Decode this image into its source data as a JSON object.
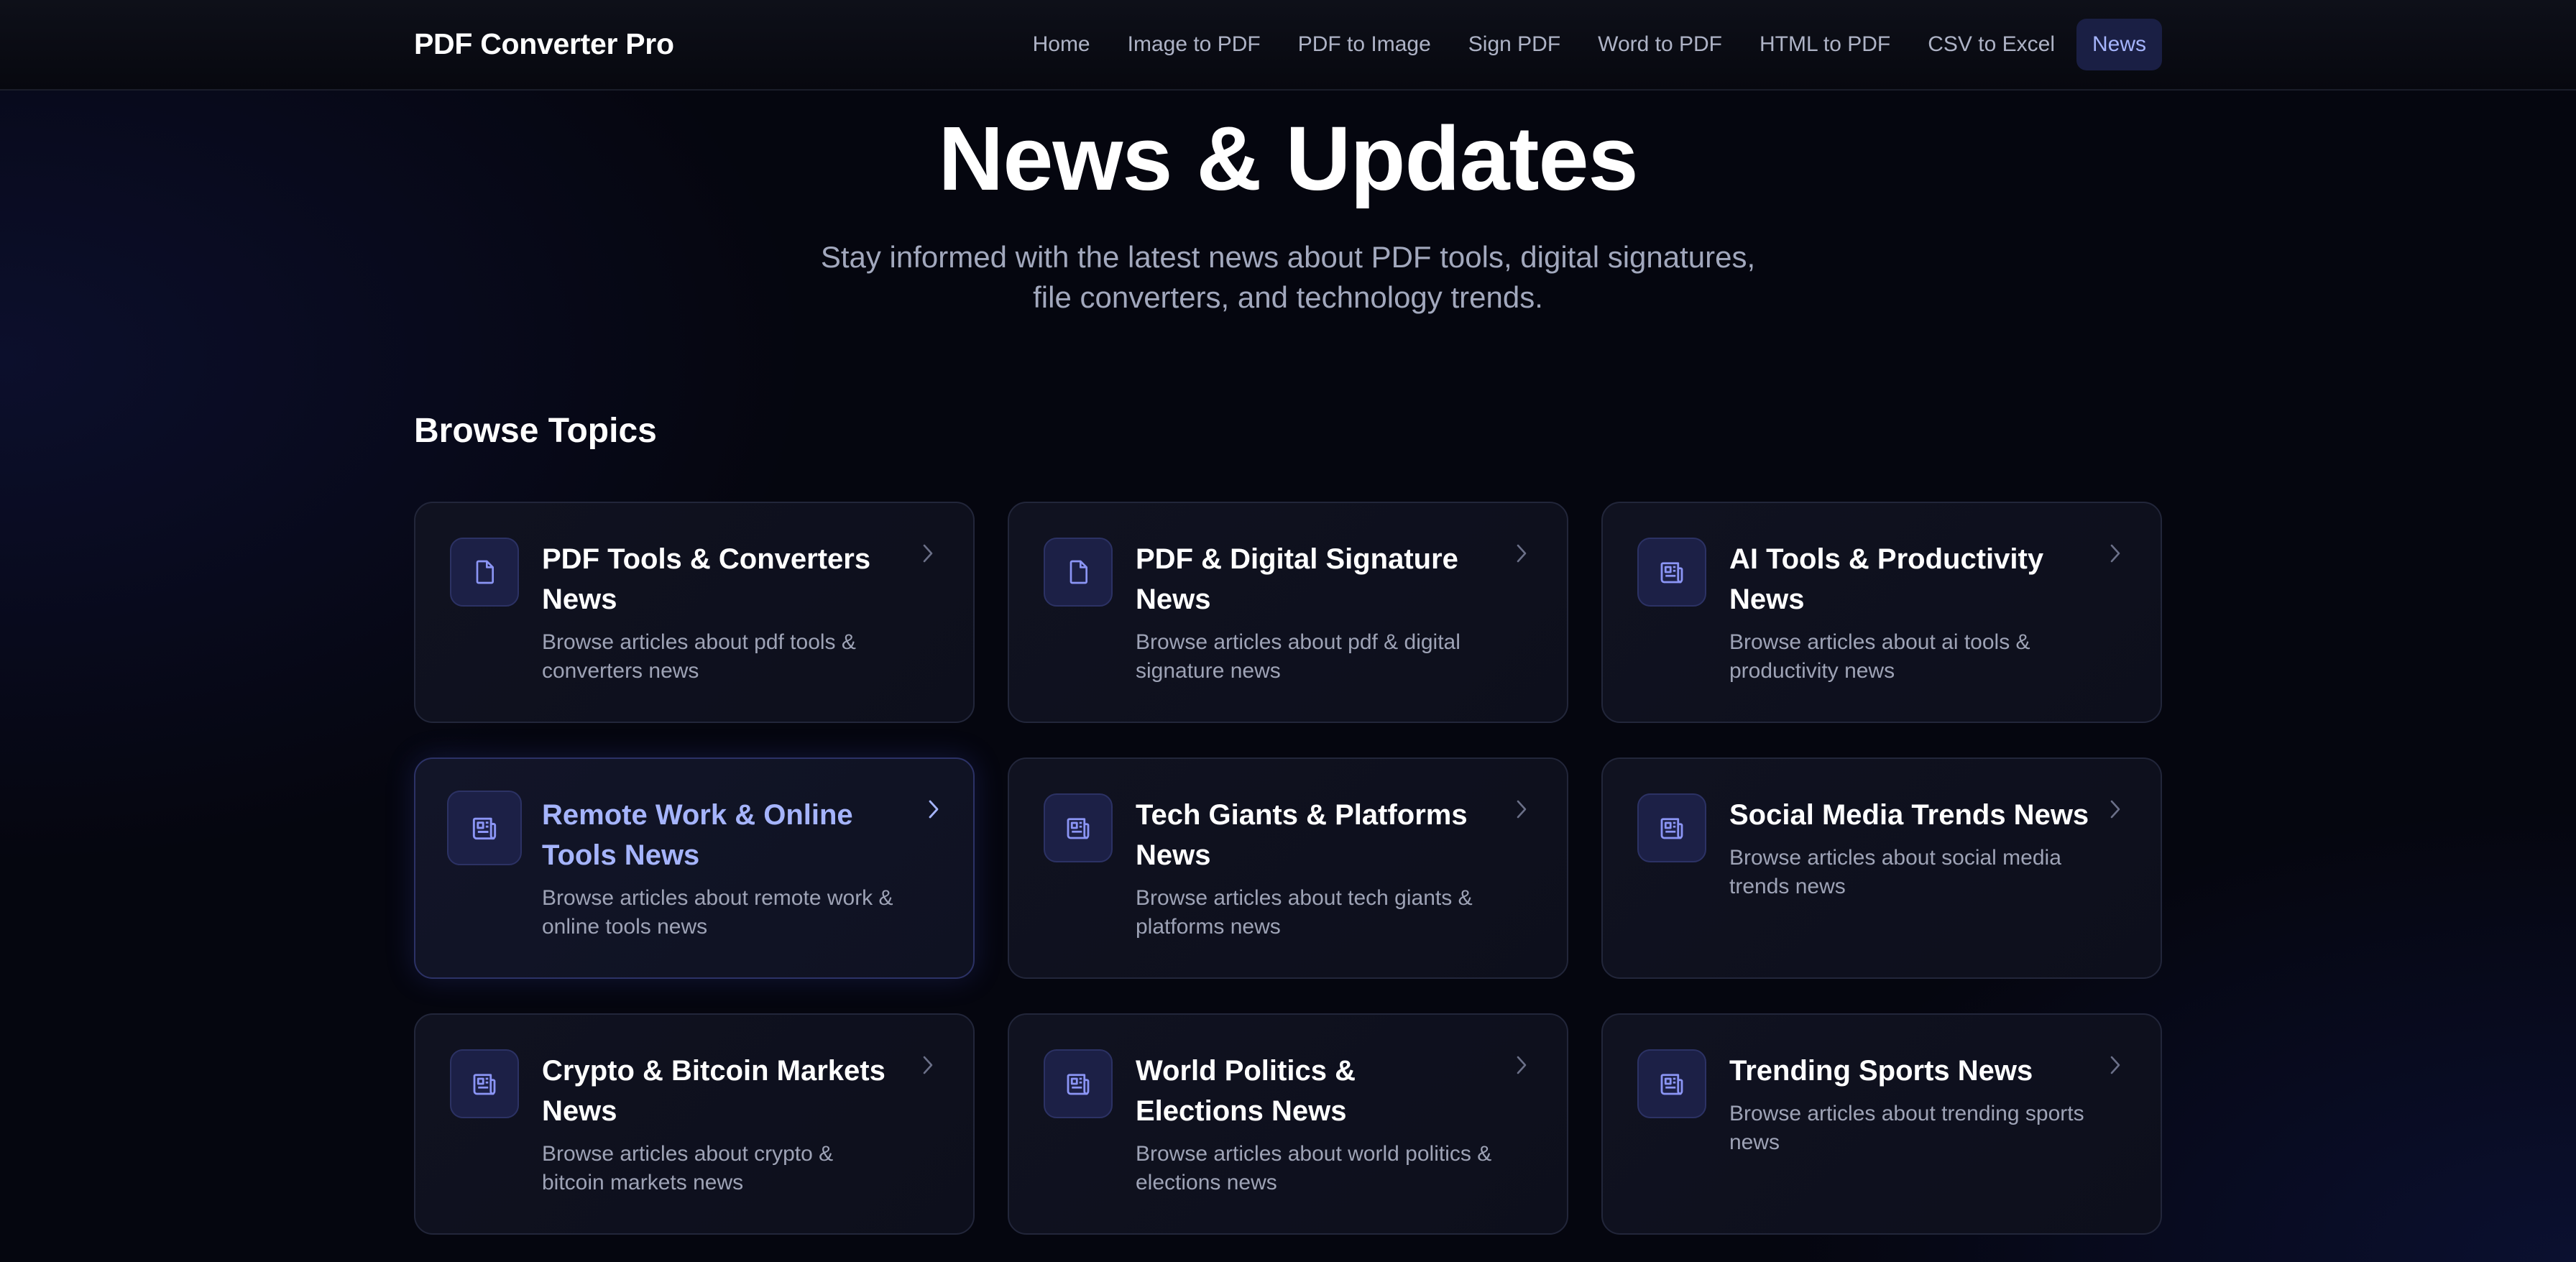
{
  "header": {
    "brand": "PDF Converter Pro",
    "nav": [
      {
        "label": "Home",
        "active": false
      },
      {
        "label": "Image to PDF",
        "active": false
      },
      {
        "label": "PDF to Image",
        "active": false
      },
      {
        "label": "Sign PDF",
        "active": false
      },
      {
        "label": "Word to PDF",
        "active": false
      },
      {
        "label": "HTML to PDF",
        "active": false
      },
      {
        "label": "CSV to Excel",
        "active": false
      },
      {
        "label": "News",
        "active": true
      }
    ]
  },
  "hero": {
    "title": "News & Updates",
    "subtitle_line1": "Stay informed with the latest news about PDF tools, digital signatures,",
    "subtitle_line2": "file converters, and technology trends."
  },
  "topics": {
    "heading": "Browse Topics",
    "cards": [
      {
        "icon": "document-icon",
        "title": "PDF Tools & Converters News",
        "description": "Browse articles about pdf tools & converters news"
      },
      {
        "icon": "document-icon",
        "title": "PDF & Digital Signature News",
        "description": "Browse articles about pdf & digital signature news"
      },
      {
        "icon": "newspaper-icon",
        "title": "AI Tools & Productivity News",
        "description": "Browse articles about ai tools & productivity news"
      },
      {
        "icon": "newspaper-icon",
        "title": "Remote Work & Online Tools News",
        "description": "Browse articles about remote work & online tools news",
        "hovered": true
      },
      {
        "icon": "newspaper-icon",
        "title": "Tech Giants & Platforms News",
        "description": "Browse articles about tech giants & platforms news"
      },
      {
        "icon": "newspaper-icon",
        "title": "Social Media Trends News",
        "description": "Browse articles about social media trends news"
      },
      {
        "icon": "newspaper-icon",
        "title": "Crypto & Bitcoin Markets News",
        "description": "Browse articles about crypto & bitcoin markets news"
      },
      {
        "icon": "newspaper-icon",
        "title": "World Politics & Elections News",
        "description": "Browse articles about world politics & elections news"
      },
      {
        "icon": "newspaper-icon",
        "title": "Trending Sports News",
        "description": "Browse articles about trending sports news"
      }
    ]
  },
  "colors": {
    "accent": "#a5b4fc",
    "icon_stroke": "#8b95f5",
    "background": "#05060f",
    "card_border": "#22263a"
  }
}
